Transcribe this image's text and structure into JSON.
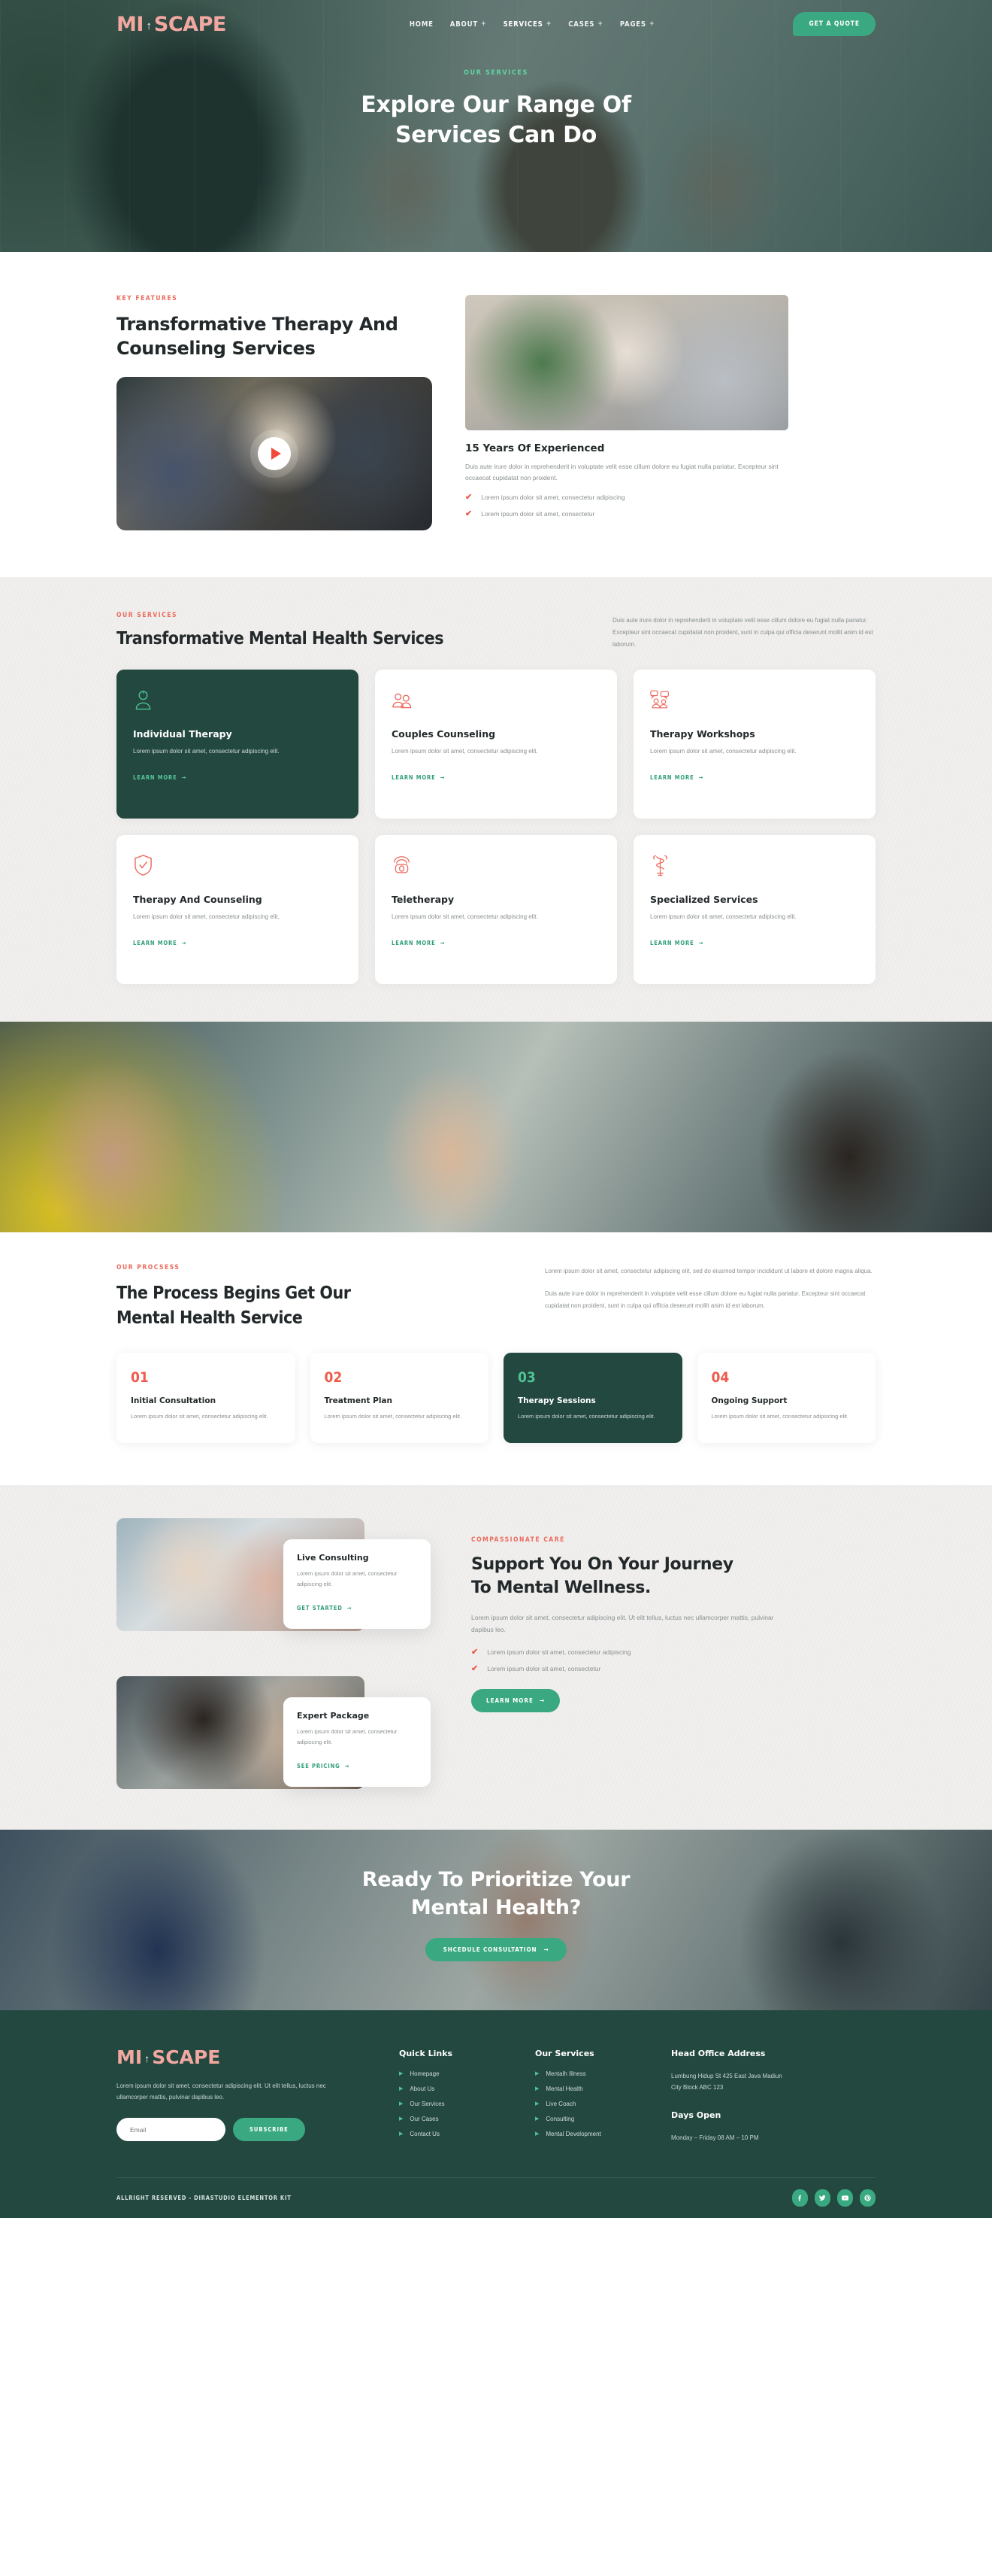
{
  "header": {
    "logo": {
      "part1": "MI",
      "arrow": "↑",
      "part2": "SCAPE"
    },
    "menu": [
      {
        "label": "HOME",
        "plus": "",
        "active": false
      },
      {
        "label": "ABOUT",
        "plus": "+",
        "active": false
      },
      {
        "label": "SERVICES",
        "plus": "+",
        "active": true
      },
      {
        "label": "CASES",
        "plus": "+",
        "active": false
      },
      {
        "label": "PAGES",
        "plus": "+",
        "active": false
      }
    ],
    "cta_label": "GET A QUOTE"
  },
  "hero": {
    "eyebrow": "OUR SERVICES",
    "title_line1": "Explore Our Range Of",
    "title_line2": "Services Can Do"
  },
  "features": {
    "eyebrow": "KEY FEATURES",
    "title_line1": "Transformative Therapy And",
    "title_line2": "Counseling Services",
    "play_icon": "play-icon",
    "sub_title": "15 Years Of Experienced",
    "paragraph": "Duis aute irure dolor in reprehenderit in voluptate velit esse cillum dolore eu fugiat nulla pariatur. Excepteur sint occaecat cupidatat non proident.",
    "checks": [
      "Lorem ipsum dolor sit amet, consectetur adipiscing",
      "Lorem ipsum dolor sit amet, consectetur"
    ]
  },
  "services": {
    "eyebrow": "OUR SERVICES",
    "title": "Transformative Mental Health Services",
    "intro": "Duis aute irure dolor in reprehenderit in voluptate velit esse cillum dolore eu fugiat nulla pariatur. Excepteur sint occaecat cupidatat non proident, sunt in culpa qui officia deserunt mollit anim id est laborum.",
    "learn_more": "LEARN MORE",
    "cards": [
      {
        "icon": "person-user-icon",
        "title": "Individual Therapy",
        "desc": "Lorem ipsum dolor sit amet, consectetur adipiscing elit.",
        "dark": true
      },
      {
        "icon": "two-people-icon",
        "title": "Couples Counseling",
        "desc": "Lorem ipsum dolor sit amet, consectetur adipiscing elit.",
        "dark": false
      },
      {
        "icon": "group-chat-icon",
        "title": "Therapy Workshops",
        "desc": "Lorem ipsum dolor sit amet, consectetur adipiscing elit.",
        "dark": false
      },
      {
        "icon": "shield-check-icon",
        "title": "Therapy And Counseling",
        "desc": "Lorem ipsum dolor sit amet, consectetur adipiscing elit.",
        "dark": false
      },
      {
        "icon": "telephone-icon",
        "title": "Teletherapy",
        "desc": "Lorem ipsum dolor sit amet, consectetur adipiscing elit.",
        "dark": false
      },
      {
        "icon": "caduceus-icon",
        "title": "Specialized Services",
        "desc": "Lorem ipsum dolor sit amet, consectetur adipiscing elit.",
        "dark": false
      }
    ]
  },
  "process": {
    "eyebrow": "OUR PROCSESS",
    "title_line1": "The Process Begins Get Our",
    "title_line2": "Mental Health Service",
    "paragraph1": "Lorem ipsum dolor sit amet, consectetur adipiscing elit, sed do eiusmod tempor incididunt ut labore et dolore magna aliqua.",
    "paragraph2": "Duis aute irure dolor in reprehenderit in voluptate velit esse cillum dolore eu fugiat nulla pariatur. Excepteur sint occaecat cupidatat non proident, sunt in culpa qui officia deserunt mollit anim id est laborum.",
    "steps": [
      {
        "num": "01",
        "title": "Initial Consultation",
        "desc": "Lorem ipsum dolor sit amet, consectetur adipiscing elit.",
        "dark": false
      },
      {
        "num": "02",
        "title": "Treatment Plan",
        "desc": "Lorem ipsum dolor sit amet, consectetur adipiscing elit.",
        "dark": false
      },
      {
        "num": "03",
        "title": "Therapy Sessions",
        "desc": "Lorem ipsum dolor sit amet, consectetur adipiscing elit.",
        "dark": true
      },
      {
        "num": "04",
        "title": "Ongoing Support",
        "desc": "Lorem ipsum dolor sit amet, consectetur adipiscing elit.",
        "dark": false
      }
    ]
  },
  "support": {
    "eyebrow": "COMPASSIONATE CARE",
    "title_line1": "Support You On Your Journey",
    "title_line2": "To Mental Wellness.",
    "paragraph": "Lorem ipsum dolor sit amet, consectetur adipiscing elit. Ut elit tellus, luctus nec ullamcorper mattis, pulvinar dapibus leo.",
    "checks": [
      "Lorem ipsum dolor sit amet, consectetur adipiscing",
      "Lorem ipsum dolor sit amet, consectetur"
    ],
    "button_label": "LEARN MORE",
    "cards": [
      {
        "title": "Live Consulting",
        "desc": "Lorem ipsum dolor sit amet, consectetur adipiscing elit.",
        "link": "GET STARTED"
      },
      {
        "title": "Expert Package",
        "desc": "Lorem ipsum dolor sit amet, consectetur adipiscing elit.",
        "link": "SEE PRICING"
      }
    ]
  },
  "cta": {
    "title_line1": "Ready To Prioritize Your",
    "title_line2": "Mental Health?",
    "button_label": "SHCEDULE CONSULTATION"
  },
  "footer": {
    "logo": {
      "part1": "MI",
      "arrow": "↑",
      "part2": "SCAPE"
    },
    "about": "Lorem ipsum dolor sit amet, consectetur adipiscing elit. Ut elit tellus, luctus nec ullamcorper mattis, pulvinar dapibus leo.",
    "email_placeholder": "Email",
    "subscribe_label": "SUBSCRIBE",
    "quick_links_title": "Quick Links",
    "quick_links": [
      "Homepage",
      "About Us",
      "Our Services",
      "Our Cases",
      "Contact Us"
    ],
    "services_title": "Our Services",
    "services_links": [
      "Mentalh Illness",
      "Mental Health",
      "Live Coach",
      "Consulting",
      "Mental Development"
    ],
    "address_title": "Head Office Address",
    "address_line1": "Lumbung Hidup St 425 East Java Madiun",
    "address_line2": "City Block ABC 123",
    "days_title": "Days Open",
    "days_value": "Monday – Friday 08 AM – 10 PM",
    "copyright": "ALLRIGHT RESERVED - DIRASTUDIO ELEMENTOR KIT",
    "socials": [
      "facebook-icon",
      "twitter-icon",
      "youtube-icon",
      "pinterest-icon"
    ]
  },
  "colors": {
    "brand_green": "#3aa981",
    "dark_green": "#23483f",
    "accent_red": "#ec6a5e",
    "logo_pink": "#f2a8a0"
  }
}
